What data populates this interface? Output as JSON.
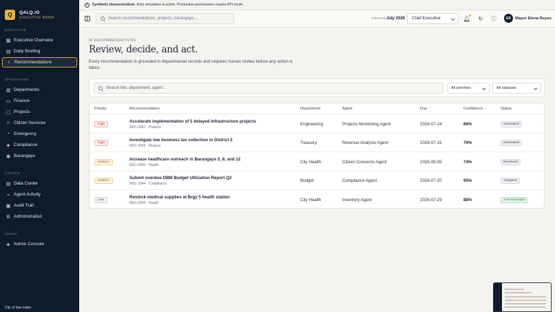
{
  "banner": {
    "strong": "Synthetic demonstration:",
    "text": "Role simulation is active. Production permissions require API mode."
  },
  "brand": {
    "logo": "Q",
    "name": "QALQ.IO",
    "subtitle": "EXECUTIVE BRAIN"
  },
  "sidebar": {
    "sections": [
      {
        "label": "EXECUTIVE",
        "items": [
          {
            "label": "Executive Overview",
            "icon": "grid-icon"
          },
          {
            "label": "Daily Briefing",
            "icon": "document-icon"
          },
          {
            "label": "Recommendations",
            "icon": "lightbulb-icon",
            "active": true
          }
        ]
      },
      {
        "label": "OPERATIONS",
        "items": [
          {
            "label": "Departments",
            "icon": "building-icon"
          },
          {
            "label": "Finance",
            "icon": "finance-icon"
          },
          {
            "label": "Projects",
            "icon": "folder-icon"
          },
          {
            "label": "Citizen Services",
            "icon": "users-icon"
          },
          {
            "label": "Emergency",
            "icon": "siren-icon"
          },
          {
            "label": "Compliance",
            "icon": "shield-icon"
          },
          {
            "label": "Barangays",
            "icon": "map-pin-icon"
          }
        ]
      },
      {
        "label": "SYSTEM",
        "items": [
          {
            "label": "Data Center",
            "icon": "database-icon"
          },
          {
            "label": "Agent Activity",
            "icon": "activity-icon"
          },
          {
            "label": "Audit Trail",
            "icon": "clipboard-icon"
          },
          {
            "label": "Administration",
            "icon": "gear-icon"
          }
        ]
      },
      {
        "label": "ADMIN",
        "items": [
          {
            "label": "Admin Console",
            "icon": "shield-icon"
          }
        ]
      }
    ],
    "footer": "City of San Isidro"
  },
  "topbar": {
    "search_placeholder": "Search recommendations, projects, barangays...",
    "period_label": "PERIOD",
    "period_value": "July 2026",
    "role": "Chief Executive",
    "user_initials": "ER",
    "user_name": "Mayor Elena Reyes"
  },
  "page": {
    "eyebrow": "AI RECOMMENDATIONS",
    "title": "Review, decide, and act.",
    "subtitle": "Every recommendation is grounded in departmental records and requires human review before any action is taken."
  },
  "filters": {
    "search_placeholder": "Search title, department, agent...",
    "priority": "All priorities",
    "status": "All statuses"
  },
  "table": {
    "headers": [
      "Priority",
      "Recommendation",
      "Department",
      "Agent",
      "Due",
      "Confidence",
      "Status"
    ],
    "rows": [
      {
        "priority": "High",
        "title": "Accelerate implementation of 5 delayed infrastructure projects",
        "sub": "REC-2041 · Projects",
        "department": "Engineering",
        "agent": "Projects Monitoring Agent",
        "due": "2026-07-24",
        "confidence": "86%",
        "status": "Generated"
      },
      {
        "priority": "High",
        "title": "Investigate low business tax collection in District 3",
        "sub": "REC-2042 · Finance",
        "department": "Treasury",
        "agent": "Revenue Analysis Agent",
        "due": "2026-07-31",
        "confidence": "79%",
        "status": "Generated"
      },
      {
        "priority": "Medium",
        "title": "Increase healthcare outreach in Barangays 5, 8, and 12",
        "sub": "REC-2043 · Health",
        "department": "City Health",
        "agent": "Citizen Concerns Agent",
        "due": "2026-08-05",
        "confidence": "74%",
        "status": "Reviewed"
      },
      {
        "priority": "Medium",
        "title": "Submit overdue DBM Budget Utilization Report Q2",
        "sub": "REC-2044 · Compliance",
        "department": "Budget",
        "agent": "Compliance Agent",
        "due": "2026-07-20",
        "confidence": "95%",
        "status": "Assigned"
      },
      {
        "priority": "Low",
        "title": "Restock medical supplies at Brgy 5 health station",
        "sub": "REC-2045 · Health",
        "department": "City Health",
        "agent": "Inventory Agent",
        "due": "2026-07-29",
        "confidence": "88%",
        "status": "Acknowledged"
      }
    ]
  },
  "colors": {
    "sidebar_bg": "#0f1a2b",
    "accent_gold": "#d8a93e",
    "priority_high": "#c0392b",
    "priority_medium": "#b7791f",
    "priority_low": "#5f6674",
    "status_acknowledged": "#2f8a4f"
  }
}
